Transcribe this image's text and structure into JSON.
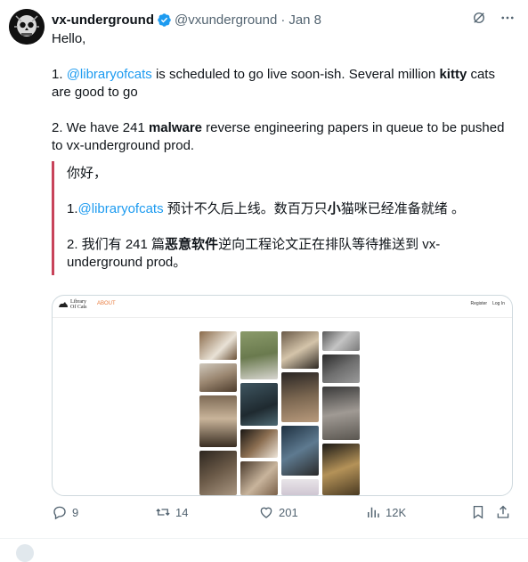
{
  "author": {
    "name": "vx-underground",
    "handle": "@vxunderground",
    "separator": "·",
    "date": "Jan 8"
  },
  "tweet": {
    "greeting": "Hello,",
    "item1": {
      "prefix": "1. ",
      "mention": "@libraryofcats",
      "middle": " is scheduled to go live soon-ish. Several million ",
      "bold": "kitty",
      "suffix": " cats are good to go"
    },
    "item2": {
      "prefix": "2. We have 241 ",
      "bold": "malware",
      "suffix": " reverse engineering papers in queue to be pushed to vx-underground prod."
    }
  },
  "quote": {
    "greeting": "你好，",
    "item1": {
      "prefix": "1.",
      "mention": "@libraryofcats",
      "middle": " 预计不久后上线。数百万只",
      "bold": "小",
      "suffix": "猫咪已经准备就绪 。"
    },
    "item2": {
      "prefix": "2. 我们有 241 篇",
      "bold": "恶意软件",
      "suffix": "逆向工程论文正在排队等待推送到 vx-underground prod。"
    }
  },
  "media": {
    "site_logo_line1": "Library",
    "site_logo_line2": "Of Cats",
    "site_accent": "ABOUT",
    "nav_register": "Register",
    "nav_login": "Log In"
  },
  "actions": {
    "replies": "9",
    "reposts": "14",
    "likes": "201",
    "views": "12K"
  },
  "colors": {
    "accent": "#1d9bf0",
    "quote_bar": "#c8435a",
    "muted": "#536471"
  }
}
